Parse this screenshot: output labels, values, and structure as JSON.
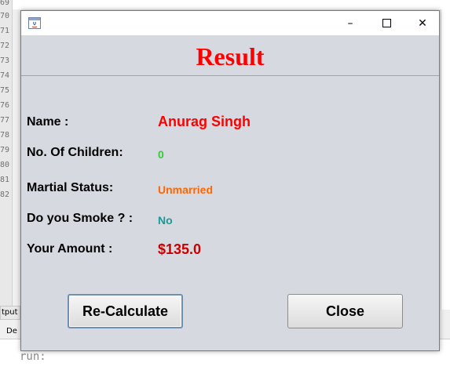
{
  "ide": {
    "line_numbers": [
      "69",
      "70",
      "71",
      "72",
      "73",
      "74",
      "75",
      "76",
      "77",
      "78",
      "79",
      "80",
      "81",
      "82"
    ],
    "output_tab": "tput",
    "de_tab": "De",
    "console_text": "run:"
  },
  "dialog": {
    "heading": "Result",
    "rows": [
      {
        "label": "Name :",
        "value": "Anurag Singh",
        "color": "#ff0000"
      },
      {
        "label": "No. Of Children:",
        "value": "0",
        "color": "#33cc33"
      },
      {
        "label": "Martial Status:",
        "value": "Unmarried",
        "color": "#ff6600"
      },
      {
        "label": "Do you Smoke ? :",
        "value": "No",
        "color": "#199999"
      },
      {
        "label": "Your Amount :",
        "value": "$135.0",
        "color": "#cc0000"
      }
    ],
    "buttons": {
      "recalculate": "Re-Calculate",
      "close": "Close"
    },
    "titlebar": {
      "minimize": "–",
      "close": "✕"
    }
  }
}
